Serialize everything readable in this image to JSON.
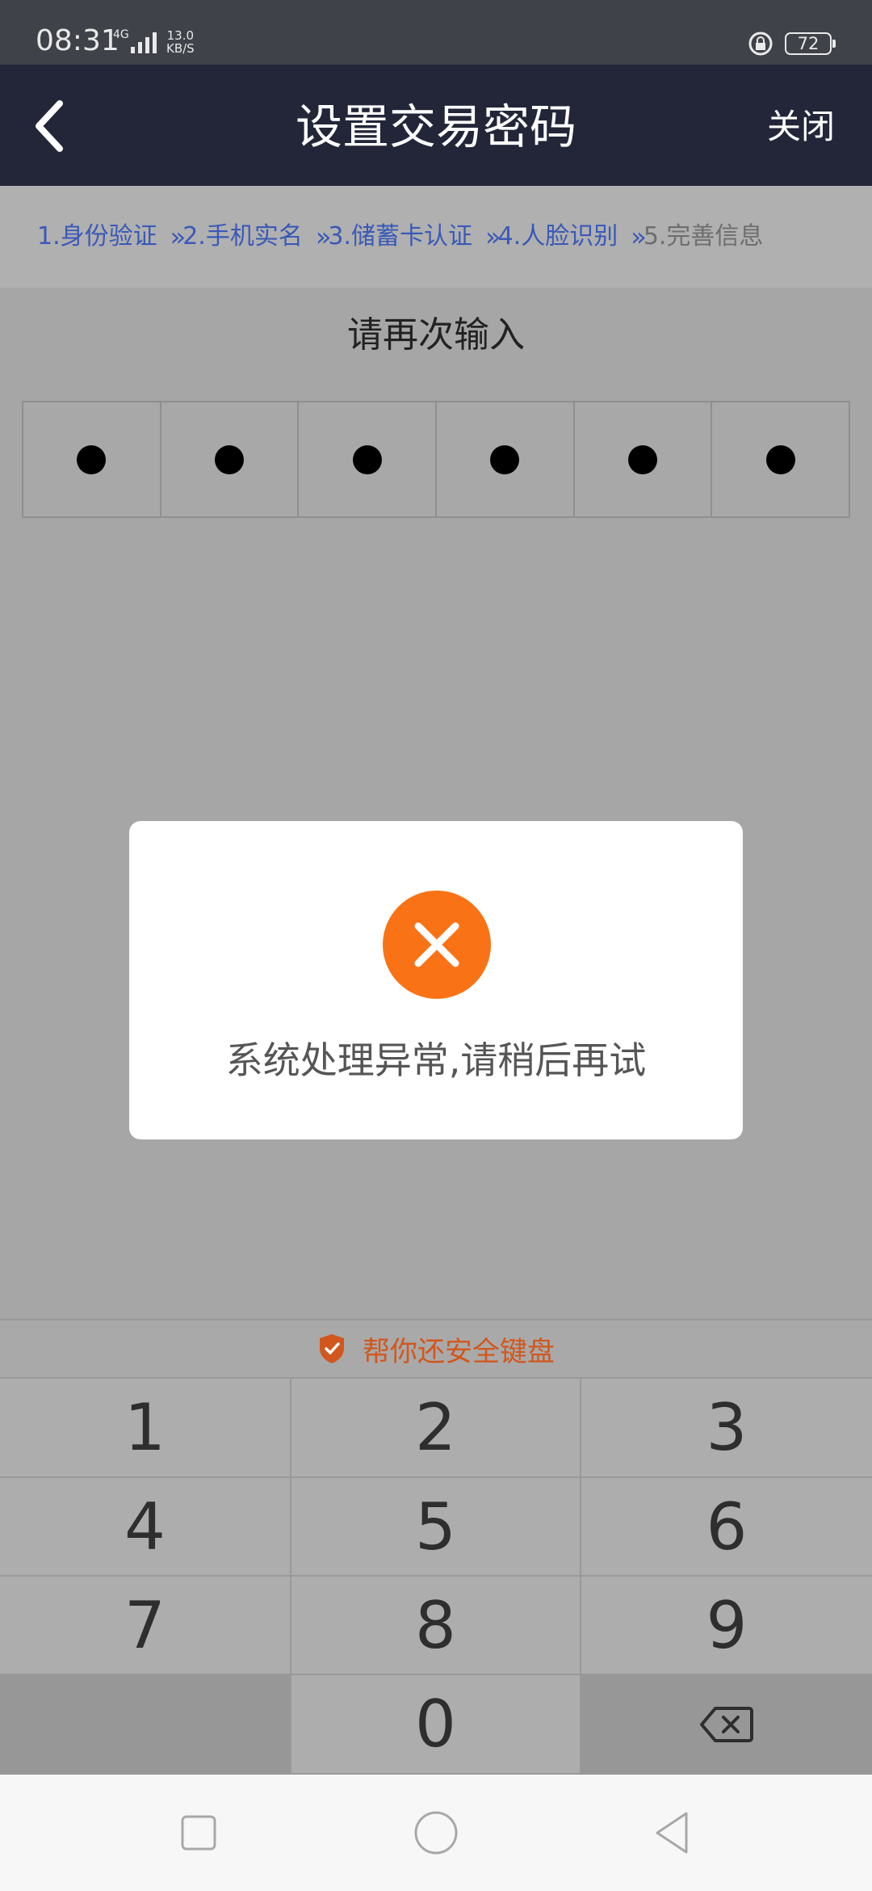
{
  "status_bar": {
    "time": "08:31",
    "network": "4G",
    "speed_value": "13.0",
    "speed_unit": "KB/S",
    "battery": "72"
  },
  "header": {
    "title": "设置交易密码",
    "close_label": "关闭"
  },
  "steps": [
    {
      "label": "1.身份验证",
      "active": true
    },
    {
      "label": "2.手机实名",
      "active": true
    },
    {
      "label": "3.储蓄卡认证",
      "active": true
    },
    {
      "label": "4.人脸识别",
      "active": true
    },
    {
      "label": "5.完善信息",
      "active": false
    }
  ],
  "step_separator": "»",
  "prompt": "请再次输入",
  "pin": {
    "length": 6,
    "filled": 6
  },
  "dialog": {
    "message": "系统处理异常,请稍后再试",
    "icon": "error-x-icon",
    "icon_color": "#f97316"
  },
  "keyboard": {
    "title": "帮你还安全键盘",
    "title_color": "#d2571d",
    "keys": [
      "1",
      "2",
      "3",
      "4",
      "5",
      "6",
      "7",
      "8",
      "9",
      "",
      "0",
      "backspace"
    ]
  },
  "nav": {
    "buttons": [
      "recent-apps-icon",
      "home-icon",
      "back-icon"
    ]
  },
  "colors": {
    "header_bg": "#222638",
    "step_active": "#3a59b8",
    "step_inactive": "#6e6e6e"
  }
}
